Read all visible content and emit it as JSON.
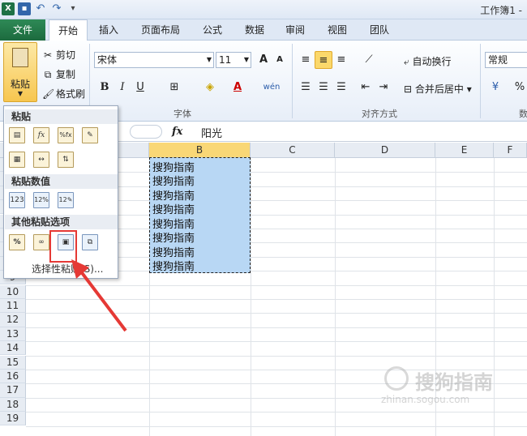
{
  "window": {
    "title": "工作簿1 -"
  },
  "tabs": [
    {
      "label": "文件"
    },
    {
      "label": "开始"
    },
    {
      "label": "插入"
    },
    {
      "label": "页面布局"
    },
    {
      "label": "公式"
    },
    {
      "label": "数据"
    },
    {
      "label": "审阅"
    },
    {
      "label": "视图"
    },
    {
      "label": "团队"
    }
  ],
  "ribbon": {
    "paste_label": "粘贴",
    "cut_label": "剪切",
    "copy_label": "复制",
    "format_painter_label": "格式刷",
    "font_name": "宋体",
    "font_size": "11",
    "font_group_label": "字体",
    "align_group_label": "对齐方式",
    "wrap_text_label": "自动换行",
    "merge_center_label": "合并后居中",
    "number_format": "常规",
    "percent_symbol": "%",
    "number_group_label": "数",
    "bold": "B",
    "italic": "I",
    "underline": "U",
    "phonetic": "wén",
    "font_color_letter": "A",
    "grow_font": "A",
    "shrink_font": "A"
  },
  "formula_bar": {
    "fx": "fx",
    "value": "阳光"
  },
  "columns": [
    "B",
    "C",
    "D",
    "E",
    "F"
  ],
  "rows": [
    "9",
    "10",
    "11",
    "12",
    "13",
    "14",
    "15",
    "16",
    "17",
    "18",
    "19"
  ],
  "cells": [
    "搜狗指南",
    "搜狗指南",
    "搜狗指南",
    "搜狗指南",
    "搜狗指南",
    "搜狗指南",
    "搜狗指南",
    "搜狗指南"
  ],
  "paste_menu": {
    "header_paste": "粘贴",
    "header_values": "粘贴数值",
    "header_other": "其他粘贴选项",
    "footer": "选择性粘贴(S)...",
    "values_icon_text": "123"
  },
  "watermark": {
    "main": "搜狗指南",
    "sub": "zhinan.sogou.com"
  },
  "colors": {
    "file_tab": "#1c6a3e",
    "selection": "#b8d7f4",
    "highlight": "#e53935",
    "arrow": "#e53935"
  }
}
